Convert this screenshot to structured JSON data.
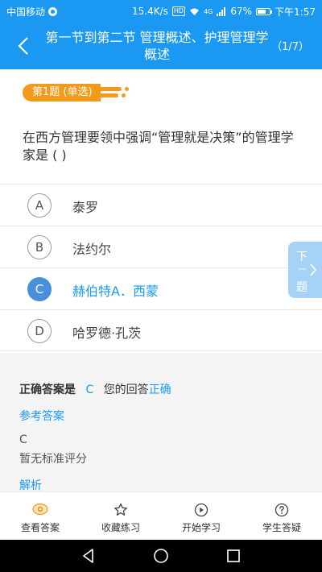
{
  "status_bar": {
    "carrier": "中国移动",
    "speed": "15.4K/s",
    "hd": "HD",
    "signal": "4G",
    "battery": "67%",
    "time": "下午1:57"
  },
  "header": {
    "title": "第一节到第二节  管理概述、护理管理学概述",
    "progress": "（1/7）"
  },
  "question": {
    "tag": "第1题 (单选)",
    "text": "在西方管理要领中强调“管理就是决策”的管理学家是 ( )"
  },
  "options": [
    {
      "letter": "A",
      "text": "泰罗"
    },
    {
      "letter": "B",
      "text": "法约尔"
    },
    {
      "letter": "C",
      "text": "赫伯特A．西蒙"
    },
    {
      "letter": "D",
      "text": "哈罗德·孔茨"
    }
  ],
  "next_button": {
    "line1": "下",
    "line2": "一",
    "line3": "题"
  },
  "answer": {
    "correct_label": "正确答案是",
    "correct_value": "C",
    "your_label": "您的回答",
    "your_result": "正确",
    "reference_label": "参考答案",
    "reference_value": "C",
    "scoring_note": "暂无标准评分",
    "analysis_label": "解析"
  },
  "tabs": [
    {
      "label": "查看答案",
      "icon": "eye-icon"
    },
    {
      "label": "收藏练习",
      "icon": "star-icon"
    },
    {
      "label": "开始学习",
      "icon": "play-icon"
    },
    {
      "label": "学生答疑",
      "icon": "question-icon"
    }
  ],
  "colors": {
    "primary": "#1a98f2",
    "tag": "#f49a1b",
    "selected_option": "#4a90d9",
    "active_tab_icon": "#f49a1b"
  }
}
